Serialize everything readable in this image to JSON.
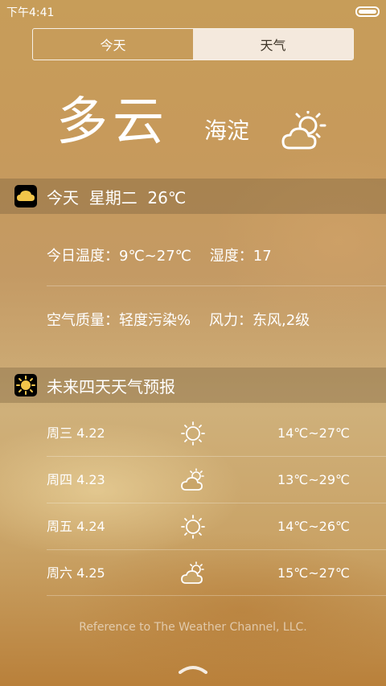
{
  "status": {
    "time": "下午4:41"
  },
  "tabs": [
    {
      "label": "今天",
      "active": false
    },
    {
      "label": "天气",
      "active": true
    }
  ],
  "hero": {
    "condition": "多云",
    "city": "海淀",
    "icon": "partly-cloudy-icon"
  },
  "today": {
    "icon": "cloud-icon",
    "header": "今天  星期二  26℃",
    "temp_line": "今日温度：9℃~27℃    湿度：17",
    "air_line": "空气质量：轻度污染%    风力：东风,2级"
  },
  "forecast": {
    "icon": "sun-icon",
    "header": "未来四天天气预报",
    "days": [
      {
        "day": "周三 4.22",
        "icon": "sun-icon",
        "temp": "14℃~27℃"
      },
      {
        "day": "周四 4.23",
        "icon": "partly-cloudy-icon",
        "temp": "13℃~29℃"
      },
      {
        "day": "周五 4.24",
        "icon": "sun-icon",
        "temp": "14℃~26℃"
      },
      {
        "day": "周六 4.25",
        "icon": "partly-cloudy-icon",
        "temp": "15℃~27℃"
      }
    ]
  },
  "footer": {
    "text": "Reference to The Weather Channel, LLC."
  },
  "colors": {
    "tab_active_bg": "#f4e9dd",
    "header_bar": "#645032"
  }
}
